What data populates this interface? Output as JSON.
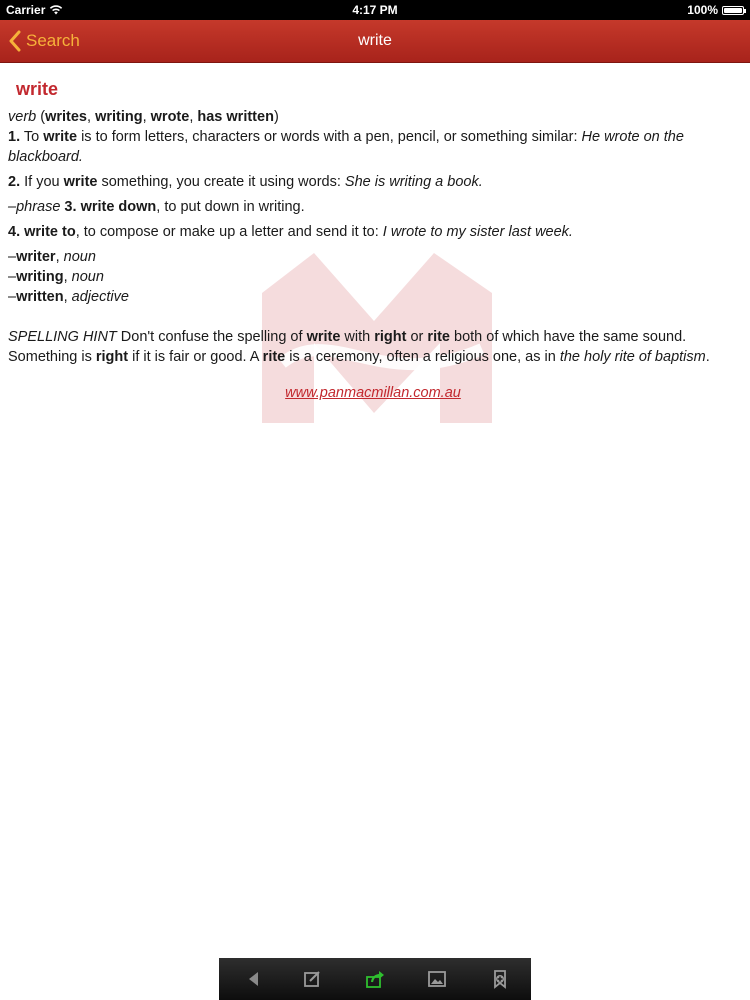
{
  "status_bar": {
    "carrier": "Carrier",
    "time": "4:17 PM",
    "battery": "100%",
    "battery_level": 1.0
  },
  "nav": {
    "back_label": "Search",
    "title": "write"
  },
  "entry": {
    "headword": "write",
    "inflections": {
      "pos": "verb",
      "open": " (",
      "forms": [
        "writes",
        "writing",
        "wrote",
        "has written"
      ],
      "sep": ", ",
      "close": ")"
    },
    "sense1": {
      "num": "1.",
      "t1": " To ",
      "b1": "write",
      "t2": " is to form letters, characters or words with a pen, pencil, or something similar: ",
      "example": "He wrote on the blackboard."
    },
    "sense2": {
      "num": "2.",
      "t1": " If you ",
      "b1": "write",
      "t2": " something, you create it using words: ",
      "example": "She is writing a book."
    },
    "sense3": {
      "prefix": "–phrase",
      "num": " 3. ",
      "phrase": "write down",
      "t1": ", to put down in writing."
    },
    "sense4": {
      "num": "4.",
      "phrase": " write to",
      "t1": ", to compose or make up a letter and send it to: ",
      "example": "I wrote to my sister last week."
    },
    "derived": [
      {
        "dash": "–",
        "word": "writer",
        "comma": ", ",
        "pos": "noun"
      },
      {
        "dash": "–",
        "word": "writing",
        "comma": ", ",
        "pos": "noun"
      },
      {
        "dash": "–",
        "word": "written",
        "comma": ", ",
        "pos": "adjective"
      }
    ],
    "hint": {
      "label": "SPELLING HINT",
      "t1": " Don't confuse the spelling of ",
      "b1": "write",
      "t2": " with ",
      "b2": "right",
      "t3": " or ",
      "b3": "rite",
      "t4": " both of which have the same sound. Something is ",
      "b4": "right",
      "t5": " if it is fair or good. A ",
      "b5": "rite",
      "t6": " is a ceremony, often a religious one, as in ",
      "i1": "the holy rite of baptism",
      "t7": "."
    },
    "link": "www.panmacmillan.com.au"
  },
  "toolbar": {
    "buttons": [
      "back-arrow-icon",
      "edit-icon",
      "share-icon",
      "image-icon",
      "bookmark-add-icon"
    ],
    "accent": "#2fbf2f"
  },
  "colors": {
    "nav_red": "#b52d22",
    "back_orange": "#f6b23a",
    "headword_red": "#c2282e"
  }
}
